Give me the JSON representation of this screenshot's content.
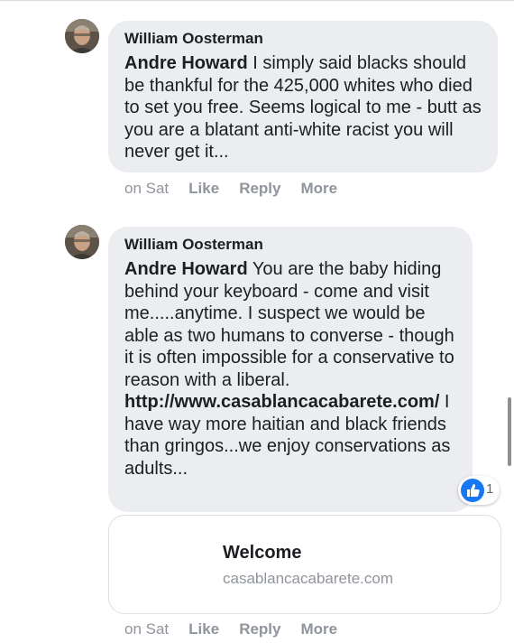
{
  "comments": [
    {
      "author": "William Oosterman",
      "mention": "Andre Howard",
      "text": " I simply said blacks should be thankful for the 425,000 whites who died to set you free. Seems logical to me - butt as you are a blatant anti-white racist you will never get it...",
      "actions": {
        "time": "on Sat",
        "like": "Like",
        "reply": "Reply",
        "more": "More"
      }
    },
    {
      "author": "William Oosterman",
      "mention": "Andre Howard",
      "text_before_link": " You are the baby hiding behind your keyboard - come and visit me.....anytime. I suspect we would be able as two humans to converse - though it is often impossible for a conservative to reason with a liberal. ",
      "link": "http://www.casablancacabarete.com/",
      "text_after_link": " I have way more haitian and black friends than gringos...we enjoy conservations as adults...",
      "reaction": {
        "icon": "thumbs-up-icon",
        "count": "1",
        "color": "#1877f2"
      },
      "link_preview": {
        "title": "Welcome",
        "domain": "casablancacabarete.com"
      },
      "actions": {
        "time": "on Sat",
        "like": "Like",
        "reply": "Reply",
        "more": "More"
      }
    }
  ],
  "colors": {
    "bubble": "#ebedf0",
    "muted": "#90949c",
    "text": "#1c1e21"
  }
}
